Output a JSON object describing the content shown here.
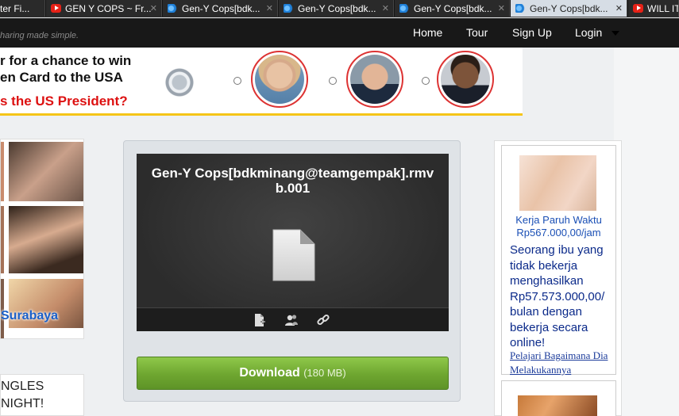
{
  "browser": {
    "tabs": [
      {
        "label": "ter Fi...",
        "icon": "none"
      },
      {
        "label": "GEN Y COPS ~ Fr...",
        "icon": "youtube-icon"
      },
      {
        "label": "Gen-Y Cops[bdk...",
        "icon": "wave-icon"
      },
      {
        "label": "Gen-Y Cops[bdk...",
        "icon": "wave-icon"
      },
      {
        "label": "Gen-Y Cops[bdk...",
        "icon": "wave-icon"
      },
      {
        "label": "Gen-Y Cops[bdk...",
        "icon": "wave-icon",
        "active": true
      },
      {
        "label": "WILL IT",
        "icon": "youtube-icon"
      }
    ],
    "close_glyph": "✕"
  },
  "site": {
    "tagline": "haring made simple.",
    "nav": {
      "home": "Home",
      "tour": "Tour",
      "signup": "Sign Up",
      "login": "Login"
    }
  },
  "banner": {
    "line1": "r for a chance to win",
    "line2": "en Card to the USA",
    "question": "s the US President?"
  },
  "left": {
    "city": "Surabaya",
    "promo_line1": "NGLES",
    "promo_line2": "NIGHT!"
  },
  "file": {
    "name": "Gen-Y Cops[bdkminang@teamgempak].rmvb.001",
    "download_label": "Download",
    "size": "(180 MB)"
  },
  "ad": {
    "title": "Kerja Paruh Waktu Rp567.000,00/jam",
    "body": "Seorang ibu yang tidak bekerja menghasilkan Rp57.573.000,00/ bulan dengan bekerja secara online!",
    "link": "Pelajari Bagaimana Dia Melakukannya"
  },
  "colors": {
    "download_green": "#6ea630",
    "accent_red": "#dd1111",
    "link_blue": "#1a4fb5"
  }
}
